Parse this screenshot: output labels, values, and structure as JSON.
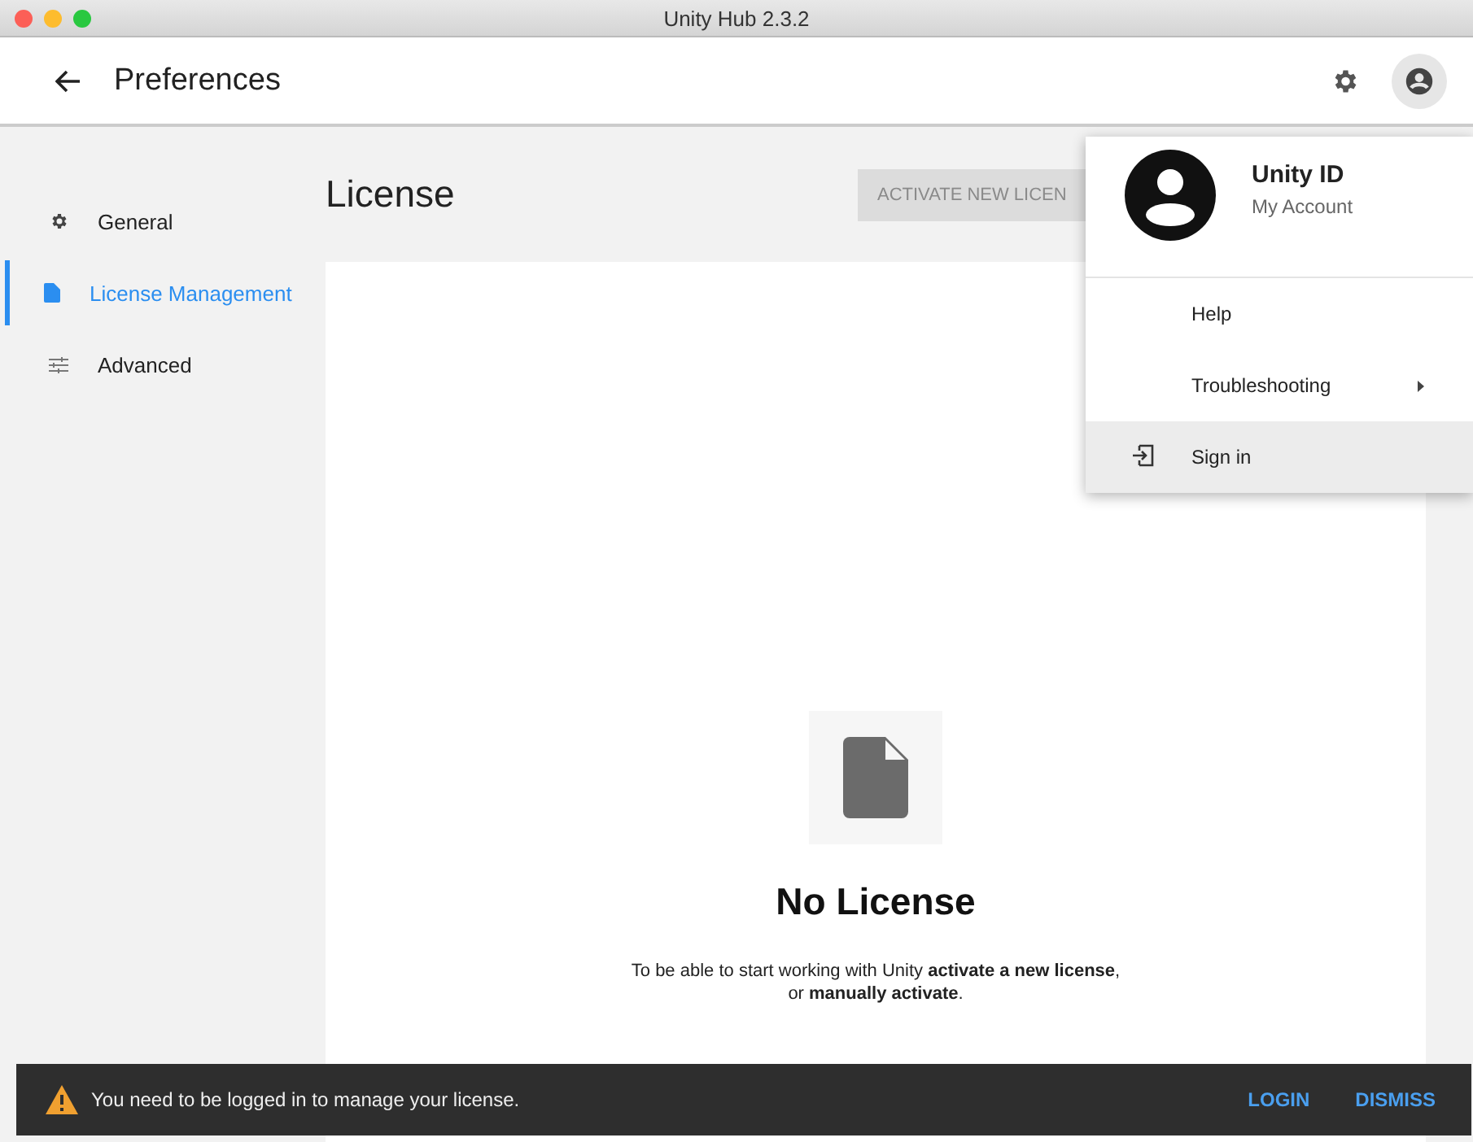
{
  "window": {
    "title": "Unity Hub 2.3.2"
  },
  "header": {
    "title": "Preferences"
  },
  "sidebar": {
    "items": [
      {
        "label": "General",
        "kind": "gear",
        "selected": false
      },
      {
        "label": "License Management",
        "kind": "file",
        "selected": true
      },
      {
        "label": "Advanced",
        "kind": "sliders",
        "selected": false
      }
    ]
  },
  "content": {
    "heading": "License",
    "activate_button": "ACTIVATE NEW LICEN",
    "empty_title": "No License",
    "empty_text": "To be able to start working with Unity **activate a new license**,\nor **manually activate**."
  },
  "account_menu": {
    "name": "Unity ID",
    "subtitle": "My Account",
    "items": [
      {
        "label": "Help",
        "kind": "plain",
        "highlighted": false
      },
      {
        "label": "Troubleshooting",
        "kind": "submenu",
        "highlighted": false
      },
      {
        "label": "Sign in",
        "kind": "signin",
        "highlighted": true
      }
    ]
  },
  "snackbar": {
    "message": "You need to be logged in to manage your license.",
    "actions": [
      "LOGIN",
      "DISMISS"
    ]
  }
}
